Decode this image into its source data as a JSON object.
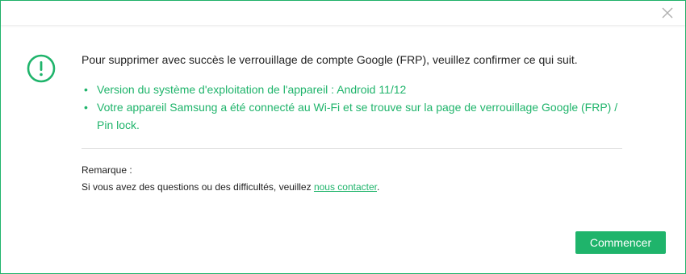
{
  "colors": {
    "accent": "#1fb46b",
    "text": "#222222",
    "divider": "#dcdcdc",
    "close_icon": "#b0b0b0"
  },
  "titlebar": {
    "close_icon": "close-icon"
  },
  "warning": {
    "icon": "exclamation-circle-icon"
  },
  "message": "Pour supprimer avec succès le verrouillage de compte Google (FRP), veuillez confirmer ce qui suit.",
  "requirements": [
    {
      "bullet": "•",
      "text": "Version du système d'exploitation de l'appareil : Android 11/12"
    },
    {
      "bullet": "•",
      "text": "Votre appareil Samsung a été connecté au Wi-Fi et se trouve sur la page de verrouillage Google (FRP) / Pin lock."
    }
  ],
  "note": {
    "label": "Remarque :",
    "text_before": "Si vous avez des questions ou des difficultés, veuillez ",
    "link": "nous contacter",
    "text_after": "."
  },
  "buttons": {
    "start_label": "Commencer"
  }
}
